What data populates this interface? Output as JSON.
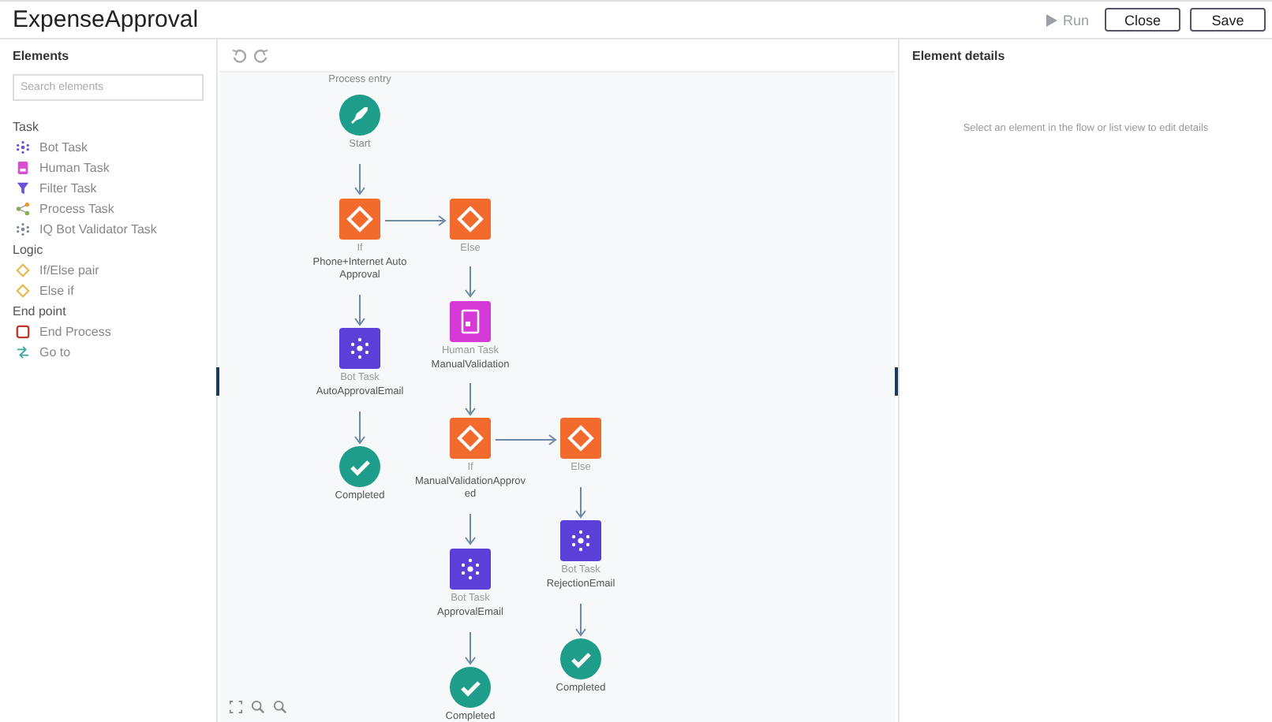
{
  "header": {
    "title": "ExpenseApproval",
    "run": "Run",
    "buttons": [
      "Close",
      "Save"
    ]
  },
  "sidebar": {
    "title": "Elements",
    "search": {
      "placeholder": "Search elements"
    },
    "groups": [
      {
        "title": "Task",
        "items": [
          {
            "kind": "bot",
            "label": "Bot Task"
          },
          {
            "kind": "human",
            "label": "Human Task"
          },
          {
            "kind": "filter",
            "label": "Filter Task"
          },
          {
            "kind": "process",
            "label": "Process Task"
          },
          {
            "kind": "iqbot",
            "label": "IQ Bot Validator Task"
          }
        ]
      },
      {
        "title": "Logic",
        "items": [
          {
            "kind": "ifelse",
            "label": "If/Else pair"
          },
          {
            "kind": "elseif",
            "label": "Else if"
          }
        ]
      },
      {
        "title": "End point",
        "items": [
          {
            "kind": "end",
            "label": "End Process"
          },
          {
            "kind": "goto",
            "label": "Go to"
          }
        ]
      }
    ]
  },
  "canvas": {
    "entry_label": "Process entry",
    "nodes": [
      {
        "kind": "start",
        "label": "Start"
      },
      {
        "kind": "if",
        "caption": "If",
        "label": "Phone+Internet Auto Approval"
      },
      {
        "kind": "if",
        "caption": "Else"
      },
      {
        "kind": "human",
        "caption": "Human Task",
        "label": "ManualValidation"
      },
      {
        "kind": "bot",
        "caption": "Bot Task",
        "label": "AutoApprovalEmail"
      },
      {
        "kind": "completed",
        "label": "Completed"
      },
      {
        "kind": "if",
        "caption": "If",
        "label": "ManualValidationApproved"
      },
      {
        "kind": "if",
        "caption": "Else"
      },
      {
        "kind": "bot",
        "caption": "Bot Task",
        "label": "ApprovalEmail"
      },
      {
        "kind": "bot",
        "caption": "Bot Task",
        "label": "RejectionEmail"
      },
      {
        "kind": "completed",
        "label": "Completed"
      },
      {
        "kind": "completed",
        "label": "Completed"
      }
    ]
  },
  "details": {
    "title": "Element details",
    "hint": "Select an element in the flow or list view to edit details"
  }
}
